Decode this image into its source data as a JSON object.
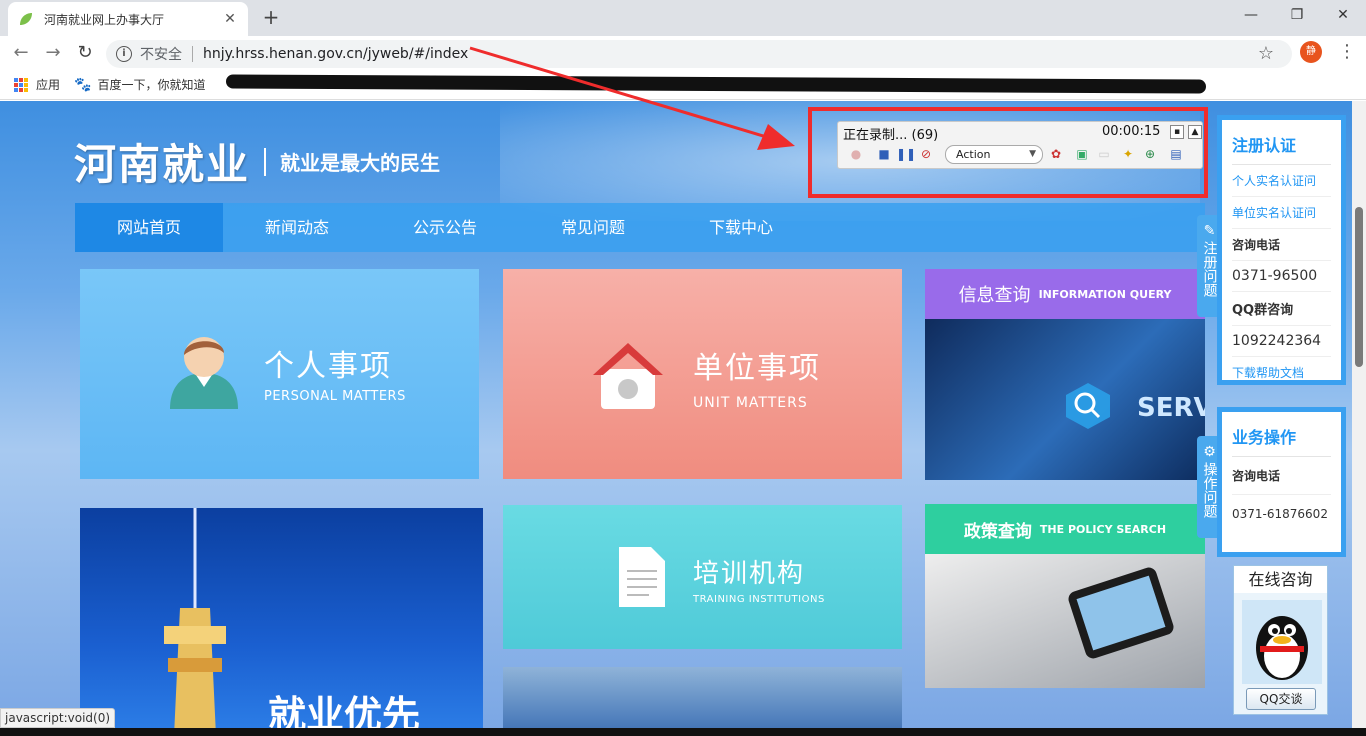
{
  "browser": {
    "tab_title": "河南就业网上办事大厅",
    "tab_close": "✕",
    "new_tab": "+",
    "window_controls": {
      "minimize": "—",
      "maximize": "❐",
      "close": "✕"
    },
    "insecure_label": "不安全",
    "url": "hnjy.hrss.henan.gov.cn/jyweb/#/index",
    "profile_initial": "静",
    "bookmarks": {
      "apps": "应用",
      "baidu": "百度一下，你就知道"
    }
  },
  "site": {
    "logo_main": "河南就业",
    "logo_slogan": "就业是最大的民生",
    "nav": [
      "网站首页",
      "新闻动态",
      "公示公告",
      "常见问题",
      "下载中心"
    ],
    "cards": {
      "personal": {
        "title": "个人事项",
        "subtitle": "PERSONAL MATTERS"
      },
      "unit": {
        "title": "单位事项",
        "subtitle": "UNIT MATTERS"
      },
      "training": {
        "title": "培训机构",
        "subtitle": "TRAINING INSTITUTIONS"
      },
      "info_query": {
        "title": "信息查询",
        "subtitle": "INFORMATION QUERY",
        "image_text": "SERVICE"
      },
      "policy": {
        "title": "政策查询",
        "subtitle": "THE POLICY SEARCH"
      },
      "city": {
        "text": "就业优先"
      }
    }
  },
  "sidebar": {
    "register_tab": "注册问题",
    "operation_tab": "操作问题",
    "register": {
      "title": "注册认证",
      "links": [
        "个人实名认证问",
        "单位实名认证问"
      ],
      "phone_label": "咨询电话",
      "phone": "0371-96500",
      "qq_label": "QQ群咨询",
      "qq": "1092242364",
      "download": "下载帮助文档"
    },
    "business": {
      "title": "业务操作",
      "phone_label": "咨询电话",
      "phone": "0371-61876602"
    },
    "qq_consult": {
      "title": "在线咨询",
      "button": "QQ交谈"
    }
  },
  "recorder": {
    "status": "正在录制... (69)",
    "timer": "00:00:15",
    "action": "Action"
  },
  "statusbar": "javascript:void(0)",
  "colors": {
    "nav_active": "#1e88e5",
    "annotation": "#ef2c2c",
    "panel_border": "#3aa0f0"
  }
}
